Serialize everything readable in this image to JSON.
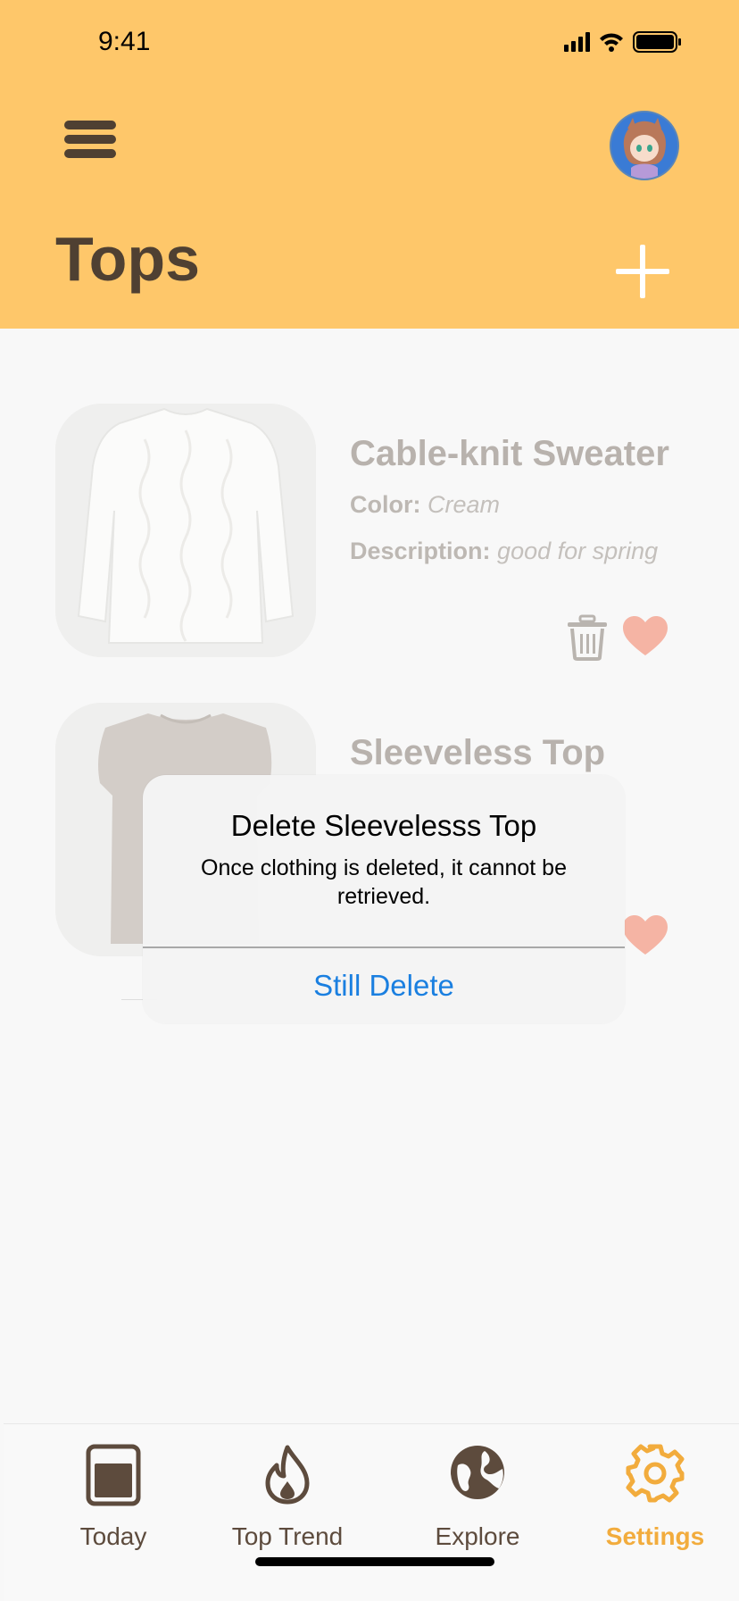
{
  "status_bar": {
    "time": "9:41"
  },
  "header": {
    "title": "Tops"
  },
  "items": [
    {
      "name": "Cable-knit Sweater",
      "color_label": "Color:",
      "color_value": "Cream",
      "description_label": "Description:",
      "description_value": "good for spring"
    },
    {
      "name": "Sleeveless Top"
    }
  ],
  "alert": {
    "title": "Delete Sleevelesss Top",
    "message": "Once clothing is deleted, it cannot be retrieved.",
    "action_label": "Still Delete"
  },
  "tabbar": {
    "tabs": [
      {
        "label": "Today",
        "icon": "today-icon"
      },
      {
        "label": "Top Trend",
        "icon": "flame-icon"
      },
      {
        "label": "Explore",
        "icon": "globe-icon"
      },
      {
        "label": "Settings",
        "icon": "gear-icon"
      }
    ],
    "active": "Settings"
  },
  "colors": {
    "header_bg": "#fec76a",
    "title_brown": "#4f4032",
    "heart": "#f5b4a4",
    "link_blue": "#1a7fe0",
    "active_tab": "#f2ac3d"
  }
}
